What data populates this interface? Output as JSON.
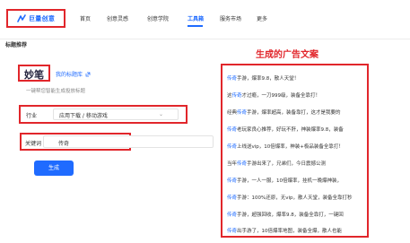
{
  "header": {
    "logo_text": "巨量创意",
    "nav": [
      "首页",
      "创意灵感",
      "创意学院",
      "工具箱",
      "服务市场",
      "更多"
    ],
    "active_nav": "工具箱"
  },
  "breadcrumb": "标题推荐",
  "tool": {
    "title": "妙笔",
    "my_library": "我的标题库",
    "subtitle": "一键帮您智能生成投放标题",
    "industry_label": "行业",
    "industry_value": "应用下载 / 移动游戏",
    "keyword_label": "关键词",
    "keyword_value": "传奇",
    "generate_button": "生成"
  },
  "results": {
    "title": "生成的广告文案",
    "keyword": "传奇",
    "items": [
      {
        "pre": "",
        "kw": "传奇",
        "post": "手游，爆率9.8，散人天堂！"
      },
      {
        "pre": "这",
        "kw": "传奇",
        "post": "才过瘾，一刀999级，装备全靠打！"
      },
      {
        "pre": "经典",
        "kw": "传奇",
        "post": "手游，爆率超高，装备靠打，这才是我要的"
      },
      {
        "pre": "",
        "kw": "传奇",
        "post": "老玩家良心推荐，好玩不肝，神装爆率9.8，装备"
      },
      {
        "pre": "",
        "kw": "传奇",
        "post": "上线送vip，10倍爆率，神装+极品装备全靠打！"
      },
      {
        "pre": "当年",
        "kw": "传奇",
        "post": "手游出来了，兄弟们，今日震撼公测"
      },
      {
        "pre": "",
        "kw": "传奇",
        "post": "手游，一人一服，10倍爆率，挂机一晚爆神装，"
      },
      {
        "pre": "",
        "kw": "传奇",
        "post": "手游：100%还原，无vip，散人天堂，装备全靠打秒"
      },
      {
        "pre": "",
        "kw": "传奇",
        "post": "手游，超强回收，爆率9.8，装备全靠打，一键回"
      },
      {
        "pre": "",
        "kw": "传奇",
        "post": "出手游了，10倍爆率地图，装备全爆，散人也能"
      }
    ]
  },
  "colors": {
    "accent": "#1f6bff",
    "highlight": "#e1262b"
  },
  "icons": {
    "logo": "logo-icon",
    "external": "external-link-icon",
    "dropdown": "chevron-down-icon"
  }
}
